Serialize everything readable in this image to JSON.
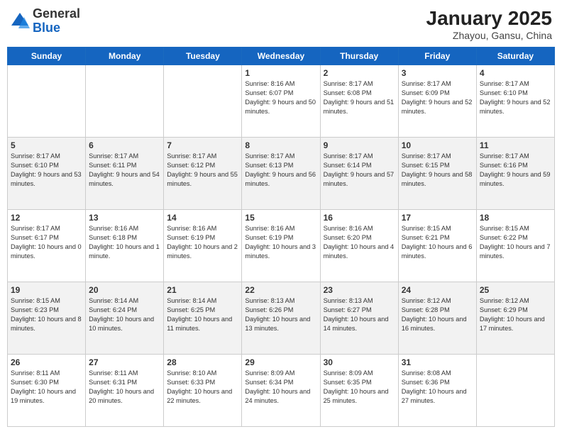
{
  "header": {
    "logo_general": "General",
    "logo_blue": "Blue",
    "month": "January 2025",
    "location": "Zhayou, Gansu, China"
  },
  "weekdays": [
    "Sunday",
    "Monday",
    "Tuesday",
    "Wednesday",
    "Thursday",
    "Friday",
    "Saturday"
  ],
  "weeks": [
    [
      {
        "day": "",
        "info": ""
      },
      {
        "day": "",
        "info": ""
      },
      {
        "day": "",
        "info": ""
      },
      {
        "day": "1",
        "info": "Sunrise: 8:16 AM\nSunset: 6:07 PM\nDaylight: 9 hours and 50 minutes."
      },
      {
        "day": "2",
        "info": "Sunrise: 8:17 AM\nSunset: 6:08 PM\nDaylight: 9 hours and 51 minutes."
      },
      {
        "day": "3",
        "info": "Sunrise: 8:17 AM\nSunset: 6:09 PM\nDaylight: 9 hours and 52 minutes."
      },
      {
        "day": "4",
        "info": "Sunrise: 8:17 AM\nSunset: 6:10 PM\nDaylight: 9 hours and 52 minutes."
      }
    ],
    [
      {
        "day": "5",
        "info": "Sunrise: 8:17 AM\nSunset: 6:10 PM\nDaylight: 9 hours and 53 minutes."
      },
      {
        "day": "6",
        "info": "Sunrise: 8:17 AM\nSunset: 6:11 PM\nDaylight: 9 hours and 54 minutes."
      },
      {
        "day": "7",
        "info": "Sunrise: 8:17 AM\nSunset: 6:12 PM\nDaylight: 9 hours and 55 minutes."
      },
      {
        "day": "8",
        "info": "Sunrise: 8:17 AM\nSunset: 6:13 PM\nDaylight: 9 hours and 56 minutes."
      },
      {
        "day": "9",
        "info": "Sunrise: 8:17 AM\nSunset: 6:14 PM\nDaylight: 9 hours and 57 minutes."
      },
      {
        "day": "10",
        "info": "Sunrise: 8:17 AM\nSunset: 6:15 PM\nDaylight: 9 hours and 58 minutes."
      },
      {
        "day": "11",
        "info": "Sunrise: 8:17 AM\nSunset: 6:16 PM\nDaylight: 9 hours and 59 minutes."
      }
    ],
    [
      {
        "day": "12",
        "info": "Sunrise: 8:17 AM\nSunset: 6:17 PM\nDaylight: 10 hours and 0 minutes."
      },
      {
        "day": "13",
        "info": "Sunrise: 8:16 AM\nSunset: 6:18 PM\nDaylight: 10 hours and 1 minute."
      },
      {
        "day": "14",
        "info": "Sunrise: 8:16 AM\nSunset: 6:19 PM\nDaylight: 10 hours and 2 minutes."
      },
      {
        "day": "15",
        "info": "Sunrise: 8:16 AM\nSunset: 6:19 PM\nDaylight: 10 hours and 3 minutes."
      },
      {
        "day": "16",
        "info": "Sunrise: 8:16 AM\nSunset: 6:20 PM\nDaylight: 10 hours and 4 minutes."
      },
      {
        "day": "17",
        "info": "Sunrise: 8:15 AM\nSunset: 6:21 PM\nDaylight: 10 hours and 6 minutes."
      },
      {
        "day": "18",
        "info": "Sunrise: 8:15 AM\nSunset: 6:22 PM\nDaylight: 10 hours and 7 minutes."
      }
    ],
    [
      {
        "day": "19",
        "info": "Sunrise: 8:15 AM\nSunset: 6:23 PM\nDaylight: 10 hours and 8 minutes."
      },
      {
        "day": "20",
        "info": "Sunrise: 8:14 AM\nSunset: 6:24 PM\nDaylight: 10 hours and 10 minutes."
      },
      {
        "day": "21",
        "info": "Sunrise: 8:14 AM\nSunset: 6:25 PM\nDaylight: 10 hours and 11 minutes."
      },
      {
        "day": "22",
        "info": "Sunrise: 8:13 AM\nSunset: 6:26 PM\nDaylight: 10 hours and 13 minutes."
      },
      {
        "day": "23",
        "info": "Sunrise: 8:13 AM\nSunset: 6:27 PM\nDaylight: 10 hours and 14 minutes."
      },
      {
        "day": "24",
        "info": "Sunrise: 8:12 AM\nSunset: 6:28 PM\nDaylight: 10 hours and 16 minutes."
      },
      {
        "day": "25",
        "info": "Sunrise: 8:12 AM\nSunset: 6:29 PM\nDaylight: 10 hours and 17 minutes."
      }
    ],
    [
      {
        "day": "26",
        "info": "Sunrise: 8:11 AM\nSunset: 6:30 PM\nDaylight: 10 hours and 19 minutes."
      },
      {
        "day": "27",
        "info": "Sunrise: 8:11 AM\nSunset: 6:31 PM\nDaylight: 10 hours and 20 minutes."
      },
      {
        "day": "28",
        "info": "Sunrise: 8:10 AM\nSunset: 6:33 PM\nDaylight: 10 hours and 22 minutes."
      },
      {
        "day": "29",
        "info": "Sunrise: 8:09 AM\nSunset: 6:34 PM\nDaylight: 10 hours and 24 minutes."
      },
      {
        "day": "30",
        "info": "Sunrise: 8:09 AM\nSunset: 6:35 PM\nDaylight: 10 hours and 25 minutes."
      },
      {
        "day": "31",
        "info": "Sunrise: 8:08 AM\nSunset: 6:36 PM\nDaylight: 10 hours and 27 minutes."
      },
      {
        "day": "",
        "info": ""
      }
    ]
  ]
}
